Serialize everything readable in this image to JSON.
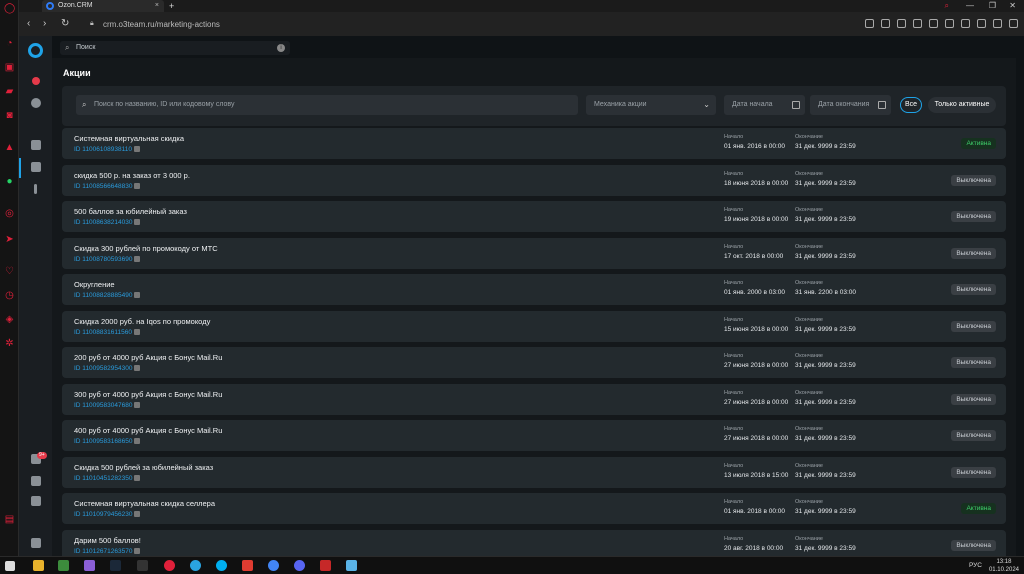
{
  "browser": {
    "tab_title": "Ozon.CRM",
    "tab_close": "×",
    "new_tab": "+",
    "url": "crm.o3team.ru/marketing-actions",
    "window_controls": [
      "—",
      "❐",
      "✕"
    ]
  },
  "app": {
    "search_placeholder": "Поиск",
    "badge": "9+"
  },
  "page": {
    "title": "Акции"
  },
  "filters": {
    "search_placeholder": "Поиск по названию, ID или кодовому слову",
    "mechanics_placeholder": "Механика акции",
    "date_start_placeholder": "Дата начала",
    "date_end_placeholder": "Дата окончания",
    "all_label": "Все",
    "only_active_label": "Только активные"
  },
  "labels": {
    "start": "Начало",
    "end": "Окончание"
  },
  "promotions": [
    {
      "name": "Системная виртуальная скидка",
      "id": "ID 11006108938110",
      "start": "01 янв. 2016 в 00:00",
      "end": "31 дек. 9999 в 23:59",
      "status": "Активна",
      "active": true
    },
    {
      "name": "скидка 500 р. на заказ от 3 000 р.",
      "id": "ID 11008566648830",
      "start": "18 июня 2018 в 00:00",
      "end": "31 дек. 9999 в 23:59",
      "status": "Выключена",
      "active": false
    },
    {
      "name": "500 баллов за юбилейный заказ",
      "id": "ID 11008638214030",
      "start": "19 июня 2018 в 00:00",
      "end": "31 дек. 9999 в 23:59",
      "status": "Выключена",
      "active": false
    },
    {
      "name": "Скидка 300 рублей по промокоду от МТС",
      "id": "ID 11008780593690",
      "start": "17 окт. 2018 в 00:00",
      "end": "31 дек. 9999 в 23:59",
      "status": "Выключена",
      "active": false
    },
    {
      "name": "Округление",
      "id": "ID 11008828885490",
      "start": "01 янв. 2000 в 03:00",
      "end": "31 янв. 2200 в 03:00",
      "status": "Выключена",
      "active": false
    },
    {
      "name": "Скидка 2000 руб. на Iqos по промокоду",
      "id": "ID 11008831611560",
      "start": "15 июня 2018 в 00:00",
      "end": "31 дек. 9999 в 23:59",
      "status": "Выключена",
      "active": false
    },
    {
      "name": "200 руб от 4000 руб Акция с Бонус Mail.Ru",
      "id": "ID 11009582954300",
      "start": "27 июня 2018 в 00:00",
      "end": "31 дек. 9999 в 23:59",
      "status": "Выключена",
      "active": false
    },
    {
      "name": "300 руб от 4000 руб Акция с Бонус Mail.Ru",
      "id": "ID 11009583047680",
      "start": "27 июня 2018 в 00:00",
      "end": "31 дек. 9999 в 23:59",
      "status": "Выключена",
      "active": false
    },
    {
      "name": "400 руб от 4000 руб Акция с Бонус Mail.Ru",
      "id": "ID 11009583168650",
      "start": "27 июня 2018 в 00:00",
      "end": "31 дек. 9999 в 23:59",
      "status": "Выключена",
      "active": false
    },
    {
      "name": "Скидка 500 рублей за юбилейный заказ",
      "id": "ID 11010451282350",
      "start": "13 июля 2018 в 15:00",
      "end": "31 дек. 9999 в 23:59",
      "status": "Выключена",
      "active": false
    },
    {
      "name": "Системная виртуальная скидка селлера",
      "id": "ID 11010979456230",
      "start": "01 янв. 2018 в 00:00",
      "end": "31 дек. 9999 в 23:59",
      "status": "Активна",
      "active": true
    },
    {
      "name": "Дарим 500 баллов!",
      "id": "ID 11012671263570",
      "start": "20 авг. 2018 в 00:00",
      "end": "31 дек. 9999 в 23:59",
      "status": "Выключена",
      "active": false
    }
  ],
  "taskbar": {
    "time": "13:18",
    "date": "01.10.2024",
    "language": "РУС"
  }
}
